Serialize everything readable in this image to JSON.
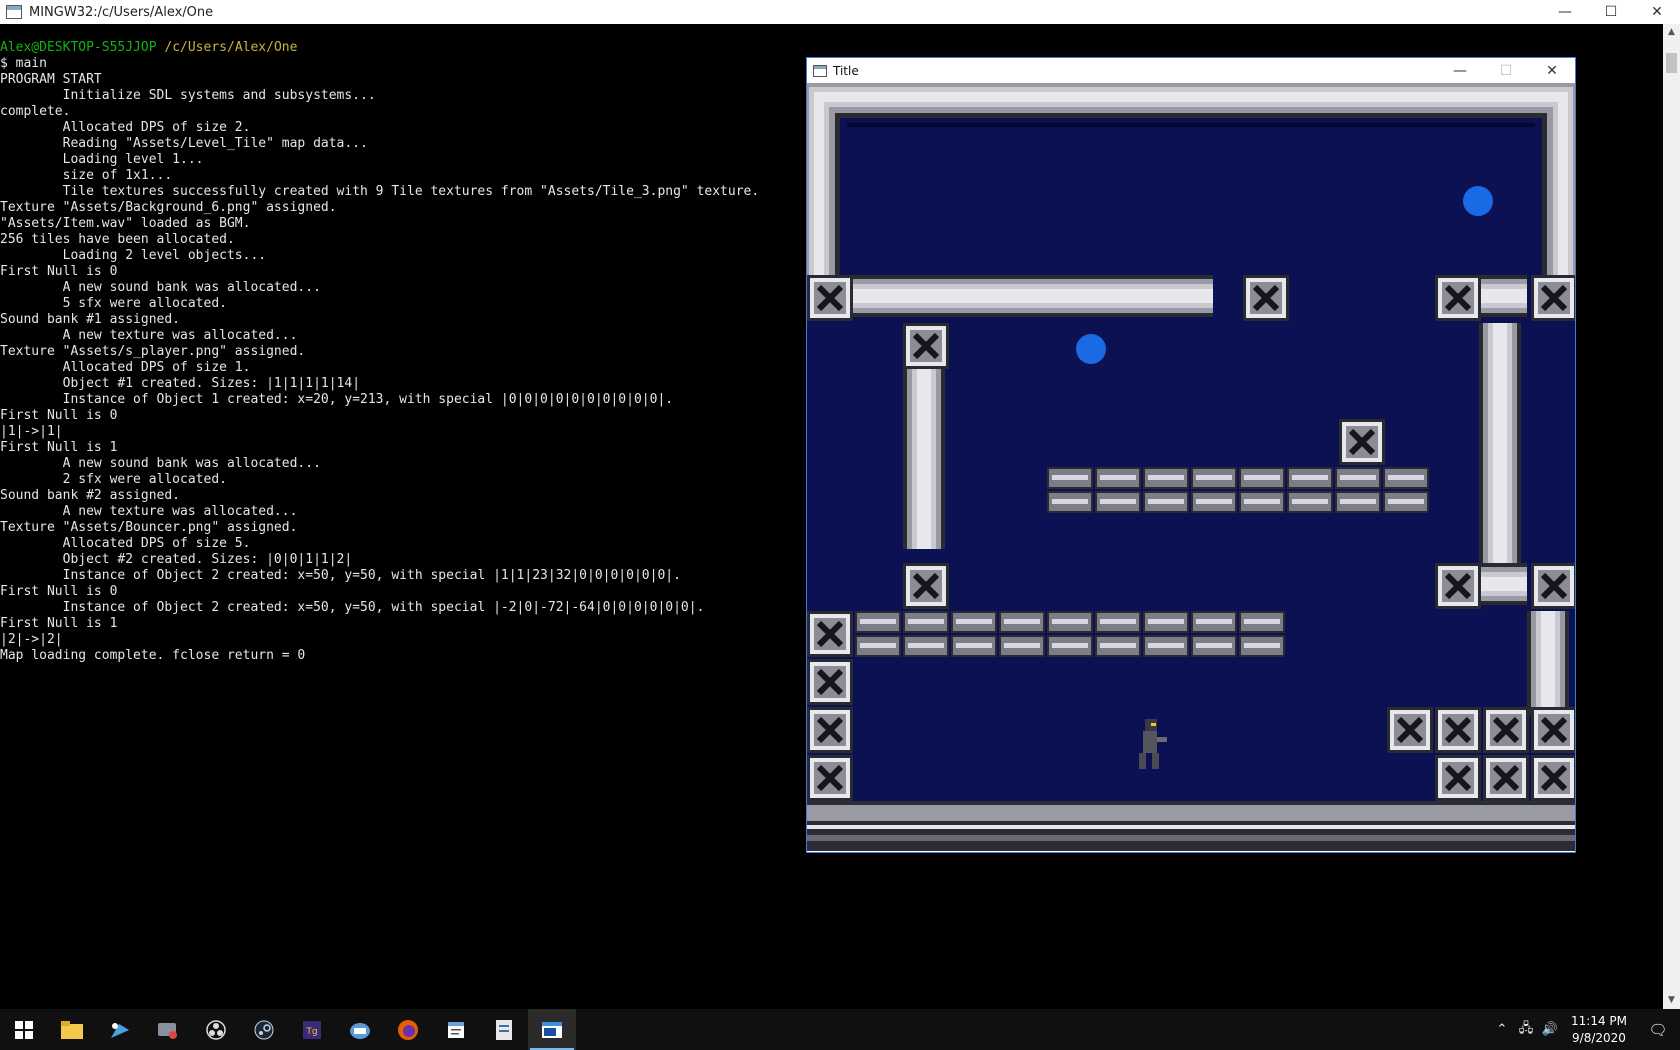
{
  "terminal": {
    "title": "MINGW32:/c/Users/Alex/One",
    "prompt_user": "Alex@DESKTOP-S55JJOP",
    "prompt_path": "/c/Users/Alex/One",
    "command": "$ main",
    "lines": [
      "PROGRAM START",
      "        Initialize SDL systems and subsystems...",
      "complete.",
      "        Allocated DPS of size 2.",
      "        Reading \"Assets/Level_Tile\" map data...",
      "        Loading level 1...",
      "        size of 1x1...",
      "        Tile textures successfully created with 9 Tile textures from \"Assets/Tile_3.png\" texture.",
      "Texture \"Assets/Background_6.png\" assigned.",
      "\"Assets/Item.wav\" loaded as BGM.",
      "256 tiles have been allocated.",
      "        Loading 2 level objects...",
      "First Null is 0",
      "        A new sound bank was allocated...",
      "        5 sfx were allocated.",
      "Sound bank #1 assigned.",
      "        A new texture was allocated...",
      "Texture \"Assets/s_player.png\" assigned.",
      "        Allocated DPS of size 1.",
      "        Object #1 created. Sizes: |1|1|1|1|14|",
      "        Instance of Object 1 created: x=20, y=213, with special |0|0|0|0|0|0|0|0|0|0|.",
      "First Null is 0",
      "|1|->|1|",
      "First Null is 1",
      "        A new sound bank was allocated...",
      "        2 sfx were allocated.",
      "Sound bank #2 assigned.",
      "        A new texture was allocated...",
      "Texture \"Assets/Bouncer.png\" assigned.",
      "        Allocated DPS of size 5.",
      "        Object #2 created. Sizes: |0|0|1|1|2|",
      "        Instance of Object 2 created: x=50, y=50, with special |1|1|23|32|0|0|0|0|0|0|.",
      "First Null is 0",
      "        Instance of Object 2 created: x=50, y=50, with special |-2|0|-72|-64|0|0|0|0|0|0|.",
      "First Null is 1",
      "|2|->|2|",
      "Map loading complete. fclose return = 0"
    ]
  },
  "window_controls": {
    "minimize": "—",
    "maximize": "☐",
    "close": "✕"
  },
  "game": {
    "title": "Title",
    "colors": {
      "background": "#0b1153",
      "orb": "#1a6ae6",
      "pipe_light": "#e8e8ec",
      "pipe_mid": "#9a9aa4",
      "pipe_dark": "#3a3a44"
    }
  },
  "taskbar": {
    "apps": [
      "start-icon",
      "file-explorer-icon",
      "paint-icon",
      "capture-icon",
      "obs-icon",
      "steam-icon",
      "game-app-icon",
      "browser-icon",
      "firefox-icon",
      "notepad-icon",
      "editor-icon",
      "terminal-icon"
    ],
    "time": "11:14 PM",
    "date": "9/8/2020"
  }
}
